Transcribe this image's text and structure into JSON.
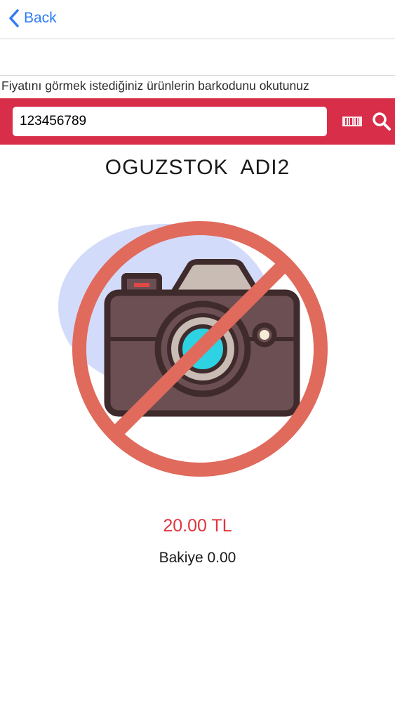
{
  "nav": {
    "back_label": "Back"
  },
  "instruction_text": "Fiyatını görmek istediğiniz ürünlerin barkodunu okutunuz",
  "search": {
    "barcode_value": "123456789"
  },
  "product": {
    "name": "OGUZSTOK  ADI2",
    "price": "20.00 TL",
    "balance": "Bakiye 0.00",
    "image_icon": "no-photo-camera-icon"
  },
  "colors": {
    "accent_bar": "#d82e4a",
    "price_text": "#e0353d",
    "link_blue": "#2f7cf6",
    "prohibit_red": "#e06a5c"
  }
}
